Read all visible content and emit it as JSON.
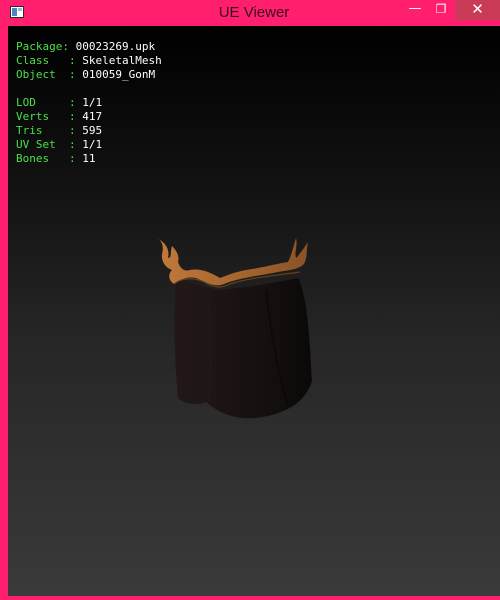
{
  "window": {
    "title": "UE Viewer"
  },
  "controls": {
    "minimize": "—",
    "maximize": "❐",
    "close": "✕"
  },
  "info": {
    "package_label": "Package: ",
    "package": "00023269.upk",
    "class_label": "Class   : ",
    "class": "SkeletalMesh",
    "object_label": "Object  : ",
    "object": "010059_GonM",
    "lod_label": "LOD     : ",
    "lod": "1/1",
    "verts_label": "Verts   : ",
    "verts": "417",
    "tris_label": "Tris    : ",
    "tris": "595",
    "uvset_label": "UV Set  : ",
    "uvset": "1/1",
    "bones_label": "Bones   : ",
    "bones": "11"
  },
  "colors": {
    "frame": "#ff1f6e",
    "label": "#4be04b",
    "value": "#ffffff",
    "mesh_body": "#1e1515",
    "mesh_trim": "#b8743a"
  }
}
